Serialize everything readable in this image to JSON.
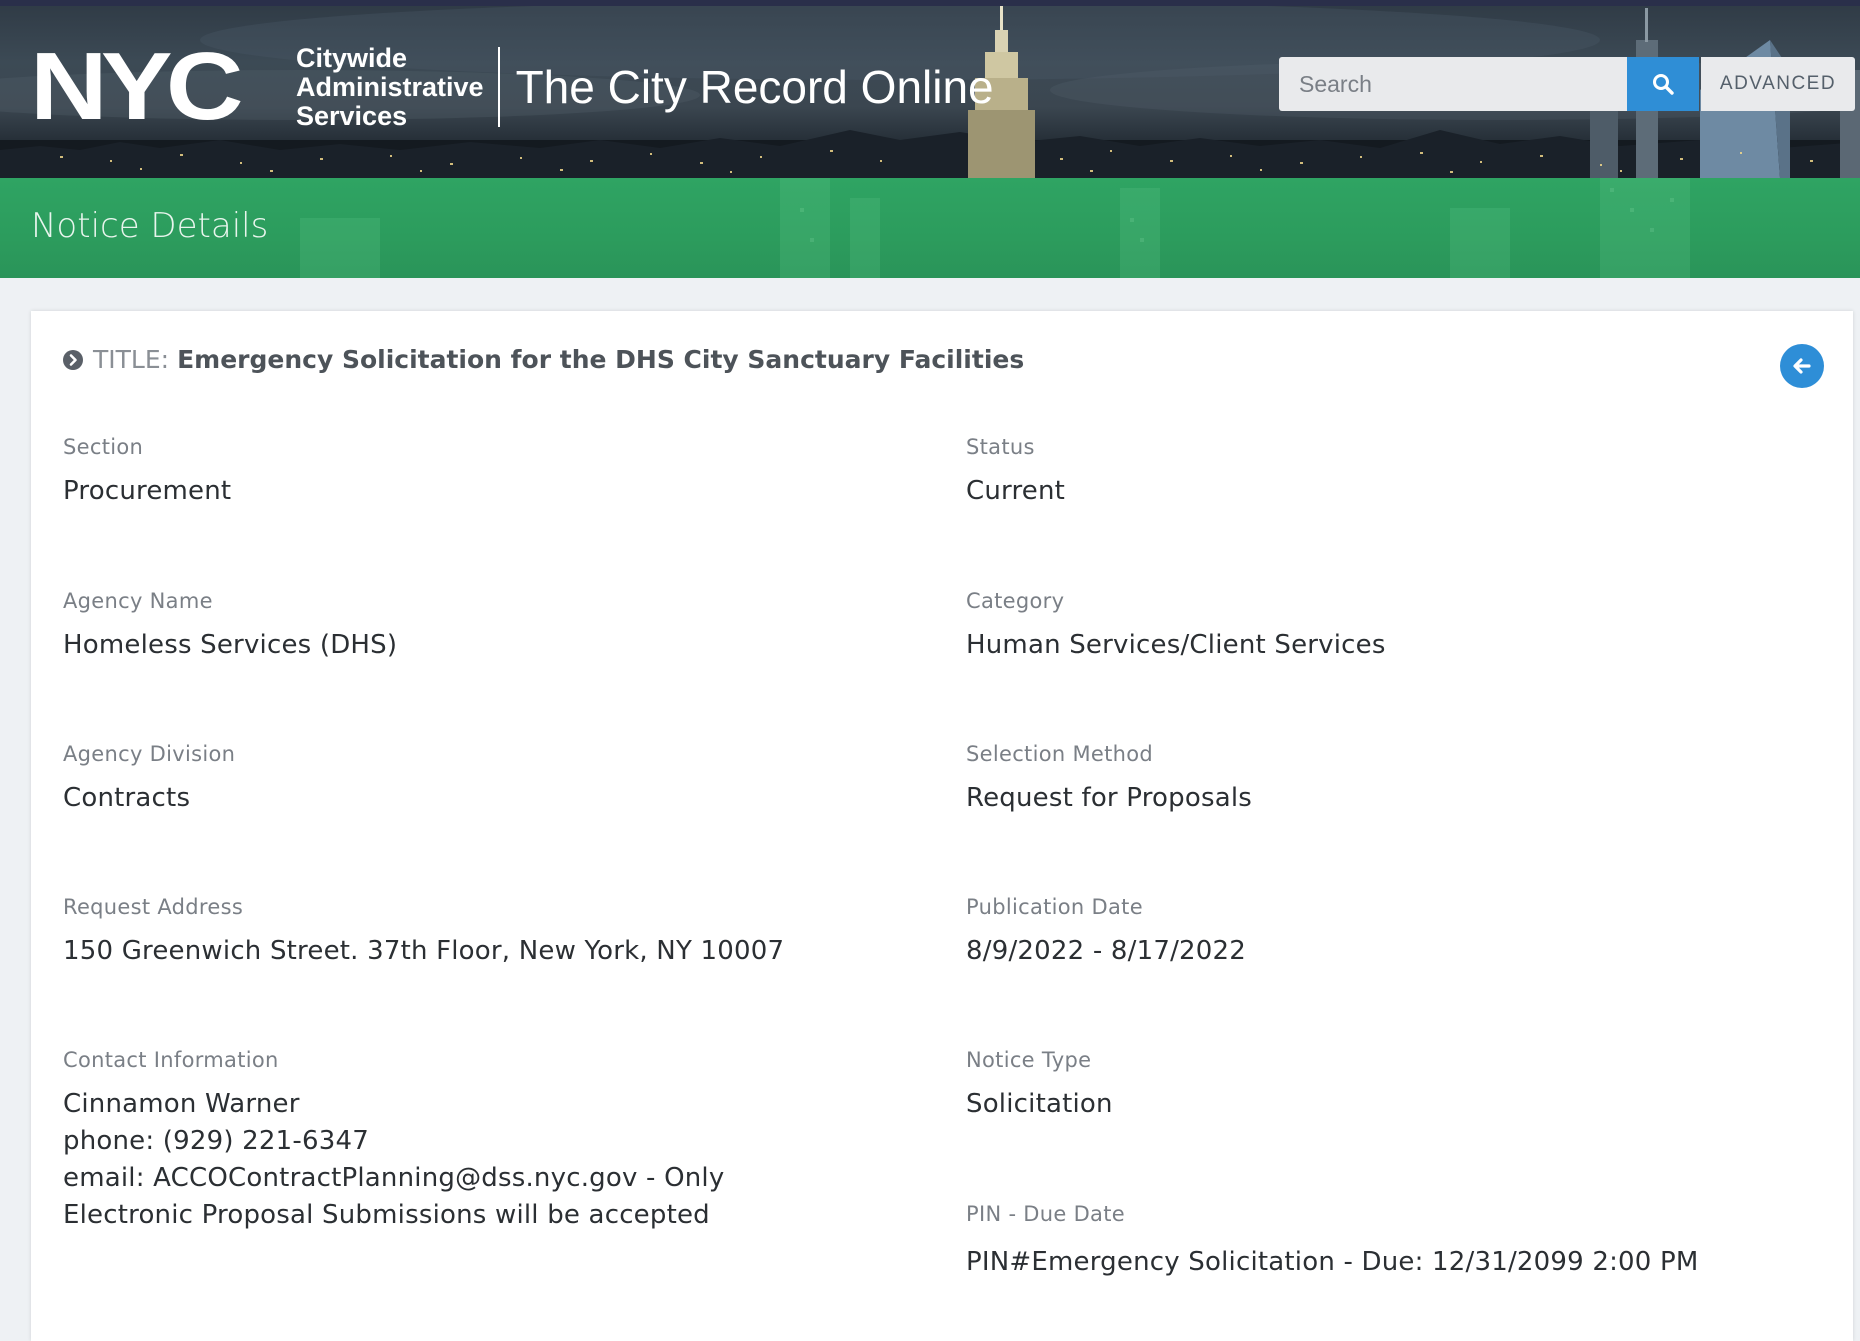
{
  "header": {
    "logo_mark": "NYC",
    "logo_words": [
      "Citywide",
      "Administrative",
      "Services"
    ],
    "site_title": "The City Record Online",
    "search_placeholder": "Search",
    "advanced_label": "ADVANCED"
  },
  "page_title": "Notice Details",
  "notice": {
    "title_label": "TITLE:",
    "title": "Emergency Solicitation for the DHS City Sanctuary Facilities",
    "fields_left": [
      {
        "label": "Section",
        "value": "Procurement"
      },
      {
        "label": "Agency Name",
        "value": "Homeless Services (DHS)"
      },
      {
        "label": "Agency Division",
        "value": "Contracts"
      },
      {
        "label": "Request Address",
        "value": "150 Greenwich Street. 37th Floor, New York, NY 10007"
      }
    ],
    "contact": {
      "label": "Contact Information",
      "name": "Cinnamon Warner",
      "phone": "phone: (929) 221-6347",
      "email": "email: ACCOContractPlanning@dss.nyc.gov - Only Electronic Proposal Submissions will be accepted"
    },
    "fields_right": [
      {
        "label": "Status",
        "value": "Current"
      },
      {
        "label": "Category",
        "value": "Human Services/Client Services"
      },
      {
        "label": "Selection Method",
        "value": "Request for Proposals"
      },
      {
        "label": "Publication Date",
        "value": "8/9/2022 - 8/17/2022"
      },
      {
        "label": "Notice Type",
        "value": "Solicitation"
      },
      {
        "label": "PIN - Due Date",
        "value": "PIN#Emergency Solicitation - Due: 12/31/2099 2:00 PM"
      }
    ]
  },
  "colors": {
    "accent_blue": "#2f8ed6",
    "band_green": "#2c9c5d"
  },
  "icons": {
    "search": "search-icon",
    "title_bullet": "chevron-circle-right-icon",
    "back": "arrow-left-icon"
  }
}
